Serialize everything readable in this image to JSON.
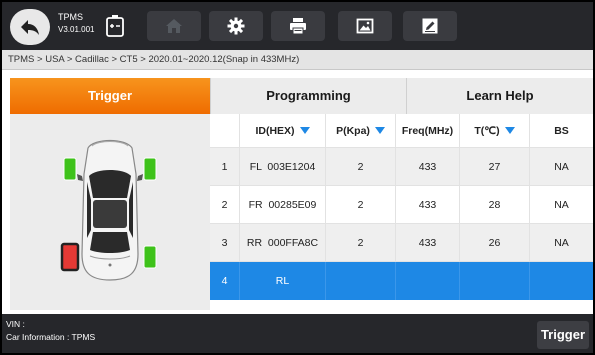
{
  "app": {
    "title": "TPMS",
    "version": "V3.01.001"
  },
  "toolbar": {
    "icons": [
      "back-arrow-icon",
      "battery-charging-icon",
      "home-icon",
      "gear-icon",
      "printer-icon",
      "image-icon",
      "edit-icon"
    ]
  },
  "breadcrumb": "TPMS > USA > Cadillac > CT5 > 2020.01~2020.12(Snap in 433MHz)",
  "tabs": [
    {
      "label": "Trigger",
      "active": true
    },
    {
      "label": "Programming",
      "active": false
    },
    {
      "label": "Learn Help",
      "active": false
    }
  ],
  "table": {
    "headers": {
      "num": "",
      "id": "ID(HEX)",
      "p": "P(Kpa)",
      "freq": "Freq(MHz)",
      "t": "T(℃)",
      "bs": "BS"
    },
    "rows": [
      {
        "num": "1",
        "id": "FL  003E1204",
        "p": "2",
        "freq": "433",
        "t": "27",
        "bs": "NA"
      },
      {
        "num": "2",
        "id": "FR  00285E09",
        "p": "2",
        "freq": "433",
        "t": "28",
        "bs": "NA"
      },
      {
        "num": "3",
        "id": "RR  000FFA8C",
        "p": "2",
        "freq": "433",
        "t": "26",
        "bs": "NA"
      },
      {
        "num": "4",
        "id": "RL",
        "p": "",
        "freq": "",
        "t": "",
        "bs": ""
      }
    ]
  },
  "tire_status": {
    "FL": "ok",
    "FR": "ok",
    "RR": "ok",
    "RL": "active"
  },
  "colors": {
    "accent": "#f7941d",
    "selected": "#1e88e5",
    "ok": "#3ec21a",
    "active": "#e53935"
  },
  "footer": {
    "vin": "VIN :",
    "car_info": "Car Information : TPMS",
    "trigger_label": "Trigger"
  }
}
